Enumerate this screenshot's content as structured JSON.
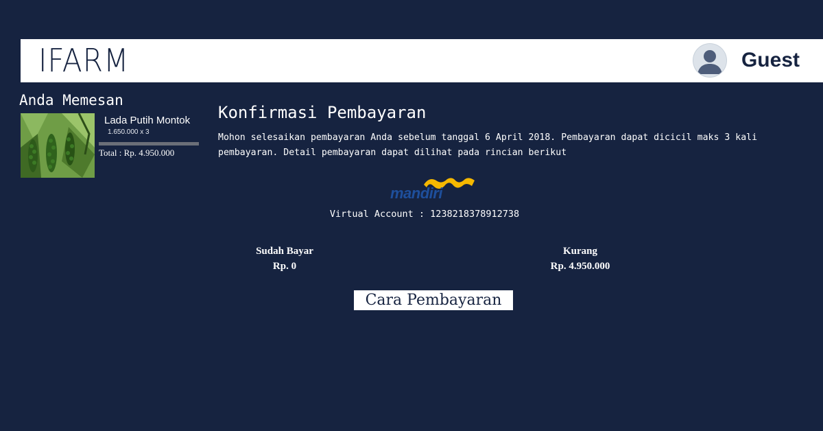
{
  "header": {
    "logo": "IFARM",
    "user_name": "Guest"
  },
  "order": {
    "title": "Anda Memesan",
    "product_name": "Lada Putih Montok",
    "quantity": "1.650.000 x 3",
    "total": "Total : Rp. 4.950.000"
  },
  "confirmation": {
    "title": "Konfirmasi Pembayaran",
    "description": "Mohon selesaikan pembayaran Anda sebelum tanggal 6 April 2018. Pembayaran dapat dicicil maks 3 kali pembayaran. Detail pembayaran dapat dilihat pada rincian berikut",
    "bank_name": "mandiri",
    "virtual_account": "Virtual Account : 1238218378912738"
  },
  "status": {
    "paid_label": "Sudah Bayar",
    "paid_value": "Rp. 0",
    "remaining_label": "Kurang",
    "remaining_value": "Rp. 4.950.000"
  },
  "actions": {
    "payment_method_label": "Cara Pembayaran"
  },
  "colors": {
    "background": "#162340",
    "header_bg": "#ffffff",
    "bank_blue": "#1e4f9c",
    "bank_gold": "#f5b800"
  }
}
